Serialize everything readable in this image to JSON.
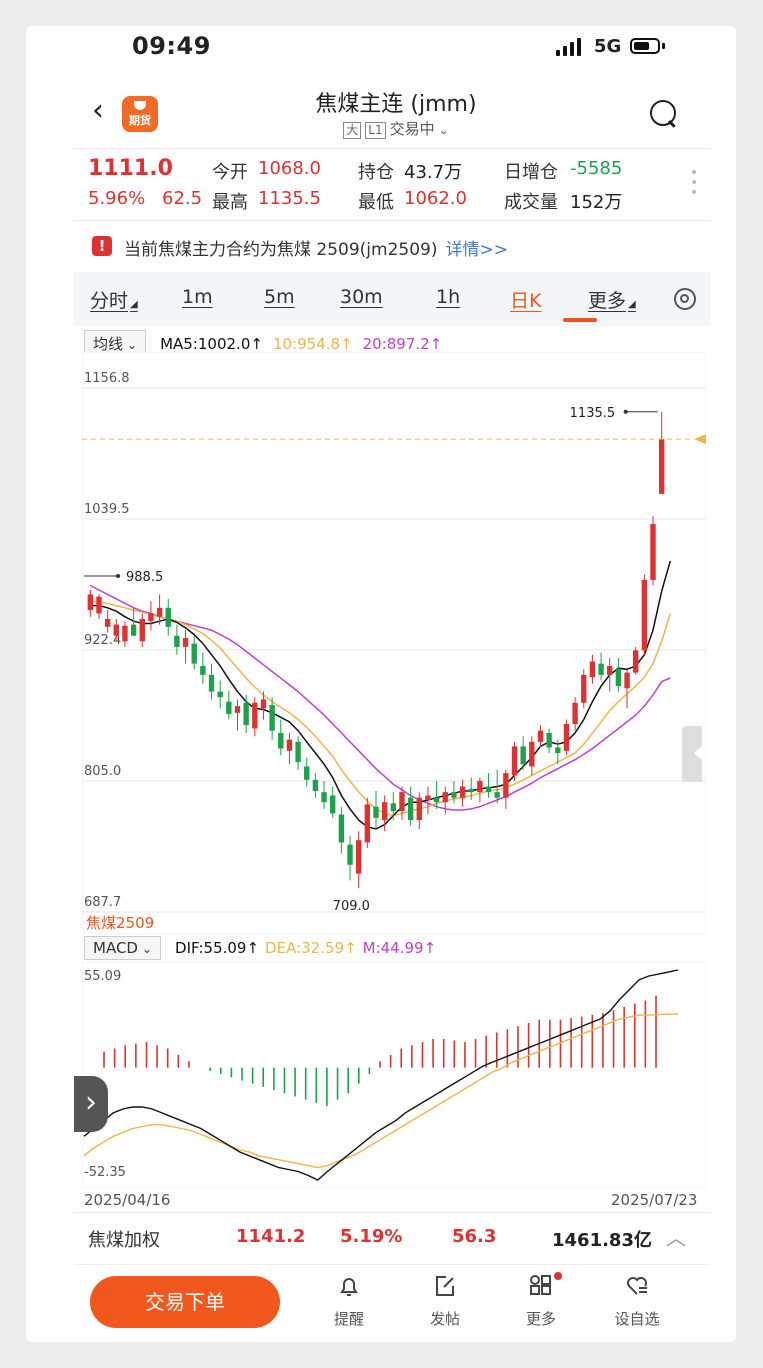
{
  "status": {
    "time": "09:49",
    "network": "5G"
  },
  "header": {
    "app_logo_text": "期货",
    "title": "焦煤主连 (jmm)",
    "tag_big": "大",
    "tag_level": "L1",
    "trade_status": "交易中"
  },
  "quote": {
    "price": "1111.0",
    "change_pct": "5.96%",
    "change": "62.5",
    "open_label": "今开",
    "open": "1068.0",
    "high_label": "最高",
    "high": "1135.5",
    "oi_label": "持仓",
    "oi": "43.7万",
    "low_label": "最低",
    "low": "1062.0",
    "oi_change_label": "日增仓",
    "oi_change": "-5585",
    "volume_label": "成交量",
    "volume": "152万"
  },
  "notice": {
    "text": "当前焦煤主力合约为焦煤 2509(jm2509)",
    "link": "详情>>"
  },
  "tabs": [
    {
      "label": "分时",
      "has_menu": true
    },
    {
      "label": "1m"
    },
    {
      "label": "5m"
    },
    {
      "label": "30m"
    },
    {
      "label": "1h"
    },
    {
      "label": "日K",
      "active": true
    },
    {
      "label": "更多",
      "has_menu": true
    }
  ],
  "ma_bar": {
    "button": "均线",
    "ma5": "MA5:1002.0↑",
    "ma10": "10:954.8↑",
    "ma20": "20:897.2↑"
  },
  "macd_bar": {
    "button": "MACD",
    "dif": "DIF:55.09↑",
    "dea": "DEA:32.59↑",
    "m": "M:44.99↑"
  },
  "colors": {
    "up": "#e03131",
    "down": "#1aa34a",
    "ma5": "#111111",
    "ma10": "#f0b547",
    "ma20": "#c23fd1",
    "accent": "#f0561c"
  },
  "chart_data": {
    "type": "candlestick",
    "price_axis": {
      "ticks": [
        1156.8,
        1039.5,
        922.4,
        805.0,
        687.7
      ],
      "tick_labels": [
        "1156.8",
        "1039.5",
        "922.4",
        "805.0",
        "687.7"
      ]
    },
    "annotations": {
      "high_label": "1135.5",
      "left_high_label": "988.5",
      "low_label": "709.0"
    },
    "contract_overlay": "焦煤2509",
    "macd_axis": {
      "top": "55.09",
      "bottom": "-52.35"
    },
    "date_start": "2025/04/16",
    "date_end": "2025/07/23",
    "candles": [
      [
        958,
        976,
        952,
        972
      ],
      [
        955,
        972,
        950,
        970
      ],
      [
        943,
        958,
        938,
        950
      ],
      [
        935,
        950,
        930,
        945
      ],
      [
        930,
        948,
        925,
        944
      ],
      [
        945,
        960,
        935,
        935
      ],
      [
        930,
        955,
        925,
        950
      ],
      [
        948,
        966,
        940,
        955
      ],
      [
        952,
        972,
        945,
        960
      ],
      [
        960,
        968,
        935,
        943
      ],
      [
        935,
        945,
        918,
        925
      ],
      [
        925,
        940,
        910,
        933
      ],
      [
        928,
        935,
        905,
        910
      ],
      [
        908,
        920,
        892,
        900
      ],
      [
        900,
        910,
        878,
        885
      ],
      [
        885,
        895,
        870,
        880
      ],
      [
        876,
        886,
        860,
        865
      ],
      [
        866,
        878,
        850,
        872
      ],
      [
        875,
        882,
        848,
        855
      ],
      [
        852,
        880,
        845,
        875
      ],
      [
        870,
        885,
        860,
        878
      ],
      [
        873,
        880,
        842,
        850
      ],
      [
        848,
        860,
        828,
        834
      ],
      [
        832,
        848,
        820,
        842
      ],
      [
        840,
        845,
        815,
        822
      ],
      [
        818,
        826,
        800,
        806
      ],
      [
        806,
        812,
        790,
        796
      ],
      [
        795,
        805,
        780,
        786
      ],
      [
        792,
        800,
        772,
        776
      ],
      [
        775,
        782,
        740,
        750
      ],
      [
        748,
        756,
        716,
        730
      ],
      [
        722,
        760,
        709,
        752
      ],
      [
        750,
        790,
        745,
        784
      ],
      [
        782,
        796,
        762,
        772
      ],
      [
        770,
        792,
        760,
        786
      ],
      [
        785,
        795,
        770,
        778
      ],
      [
        778,
        800,
        770,
        795
      ],
      [
        790,
        800,
        765,
        770
      ],
      [
        770,
        795,
        762,
        790
      ],
      [
        788,
        800,
        775,
        792
      ],
      [
        790,
        805,
        780,
        786
      ],
      [
        786,
        800,
        775,
        795
      ],
      [
        795,
        805,
        785,
        790
      ],
      [
        790,
        806,
        782,
        800
      ],
      [
        798,
        808,
        788,
        795
      ],
      [
        795,
        808,
        786,
        805
      ],
      [
        800,
        812,
        790,
        795
      ],
      [
        795,
        815,
        785,
        790
      ],
      [
        790,
        815,
        780,
        812
      ],
      [
        810,
        840,
        805,
        836
      ],
      [
        836,
        845,
        815,
        820
      ],
      [
        818,
        845,
        810,
        840
      ],
      [
        840,
        855,
        835,
        850
      ],
      [
        848,
        852,
        830,
        835
      ],
      [
        835,
        842,
        820,
        830
      ],
      [
        832,
        860,
        828,
        856
      ],
      [
        856,
        880,
        850,
        875
      ],
      [
        875,
        905,
        870,
        900
      ],
      [
        898,
        918,
        892,
        912
      ],
      [
        910,
        920,
        895,
        900
      ],
      [
        900,
        915,
        885,
        908
      ],
      [
        905,
        915,
        885,
        890
      ],
      [
        888,
        905,
        870,
        902
      ],
      [
        902,
        925,
        900,
        922
      ],
      [
        922,
        990,
        918,
        985
      ],
      [
        985,
        1042,
        980,
        1035
      ],
      [
        1062,
        1135.5,
        1062,
        1111
      ]
    ],
    "ma5": [
      962,
      962,
      960,
      957,
      952,
      948,
      946,
      946,
      948,
      950,
      947,
      942,
      936,
      928,
      918,
      908,
      896,
      885,
      876,
      870,
      869,
      866,
      862,
      858,
      850,
      840,
      830,
      820,
      808,
      792,
      780,
      770,
      764,
      762,
      766,
      774,
      782,
      786,
      786,
      788,
      790,
      792,
      794,
      796,
      796,
      798,
      799,
      800,
      802,
      810,
      818,
      826,
      836,
      840,
      838,
      840,
      848,
      860,
      876,
      890,
      900,
      906,
      905,
      908,
      918,
      940,
      975,
      1002
    ],
    "ma10": [
      966,
      965,
      964,
      962,
      960,
      958,
      956,
      954,
      952,
      950,
      948,
      945,
      941,
      937,
      931,
      924,
      915,
      906,
      897,
      889,
      882,
      876,
      871,
      866,
      860,
      853,
      845,
      836,
      827,
      815,
      805,
      795,
      787,
      780,
      776,
      774,
      776,
      778,
      780,
      782,
      785,
      787,
      789,
      790,
      792,
      794,
      796,
      797,
      799,
      802,
      806,
      810,
      814,
      818,
      822,
      826,
      830,
      838,
      848,
      858,
      868,
      876,
      883,
      890,
      898,
      910,
      930,
      954.8
    ],
    "ma20": [
      980,
      976,
      972,
      968,
      964,
      960,
      957,
      955,
      952,
      950,
      948,
      946,
      944,
      942,
      940,
      936,
      932,
      927,
      921,
      915,
      909,
      903,
      897,
      891,
      885,
      878,
      871,
      864,
      856,
      848,
      840,
      832,
      824,
      816,
      809,
      802,
      797,
      792,
      788,
      785,
      782,
      780,
      779,
      779,
      780,
      782,
      785,
      788,
      791,
      795,
      799,
      803,
      808,
      812,
      816,
      820,
      824,
      829,
      834,
      840,
      846,
      852,
      858,
      864,
      872,
      882,
      894,
      897.2
    ],
    "macd_dif": [
      -30,
      -26,
      -22,
      -18,
      -16,
      -15,
      -15,
      -16,
      -18,
      -20,
      -22,
      -24,
      -26,
      -29,
      -32,
      -35,
      -38,
      -40,
      -42,
      -44,
      -46,
      -47,
      -48,
      -50,
      -52.35,
      -48,
      -44,
      -40,
      -36,
      -32,
      -28,
      -25,
      -22,
      -18,
      -15,
      -12,
      -9,
      -6,
      -3,
      0,
      3,
      6,
      8,
      10,
      12,
      14,
      16,
      18,
      20,
      22,
      24,
      26,
      28,
      30,
      34,
      40,
      45,
      50,
      52,
      53,
      54,
      55.09
    ],
    "macd_dea": [
      -40,
      -36,
      -33,
      -30,
      -28,
      -26,
      -25,
      -24,
      -24,
      -25,
      -26,
      -27,
      -29,
      -31,
      -33,
      -35,
      -37,
      -38,
      -40,
      -41,
      -42,
      -43,
      -44,
      -45,
      -46,
      -45,
      -43,
      -41,
      -39,
      -36,
      -33,
      -30,
      -27,
      -24,
      -21,
      -18,
      -15,
      -12,
      -9,
      -6,
      -3,
      0,
      3,
      5,
      8,
      10,
      12,
      14,
      16,
      18,
      20,
      22,
      24,
      26,
      28,
      30,
      31,
      32,
      32,
      32.3,
      32.5,
      32.59
    ],
    "macd_hist": [
      10,
      12,
      14,
      15,
      16,
      14,
      12,
      8,
      4,
      0,
      -2,
      -4,
      -6,
      -8,
      -10,
      -12,
      -14,
      -16,
      -18,
      -20,
      -22,
      -24,
      -20,
      -16,
      -10,
      -4,
      4,
      8,
      12,
      14,
      16,
      18,
      18,
      17,
      16,
      18,
      20,
      22,
      24,
      26,
      28,
      30,
      30,
      30,
      31,
      32,
      33,
      34,
      36,
      38,
      40,
      42,
      44.99
    ]
  },
  "footer_quote": {
    "name": "焦煤加权",
    "price": "1141.2",
    "pct": "5.19%",
    "change": "56.3",
    "amount": "1461.83亿"
  },
  "bottom_nav": {
    "order_button": "交易下单",
    "items": [
      "提醒",
      "发帖",
      "更多",
      "设自选"
    ]
  }
}
